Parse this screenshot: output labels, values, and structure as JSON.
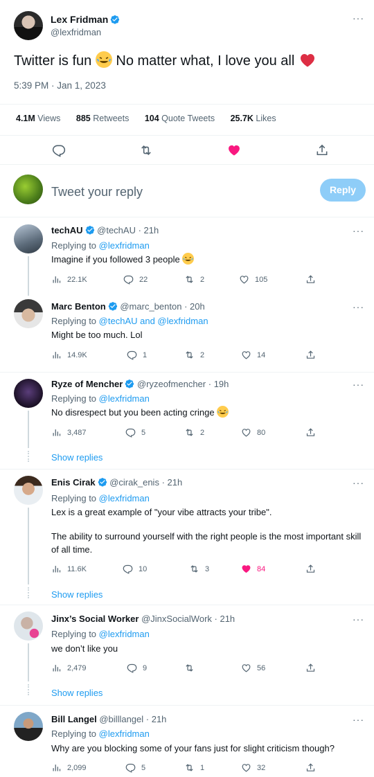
{
  "main_tweet": {
    "name": "Lex Fridman",
    "handle": "@lexfridman",
    "text": "Twitter is fun",
    "text2": "No matter what, I love you all",
    "time": "5:39 PM · Jan 1, 2023",
    "stats": {
      "views_num": "4.1M",
      "views_label": "Views",
      "retweets_num": "885",
      "retweets_label": "Retweets",
      "quotes_num": "104",
      "quotes_label": "Quote Tweets",
      "likes_num": "25.7K",
      "likes_label": "Likes"
    }
  },
  "reply_box": {
    "placeholder": "Tweet your reply",
    "button": "Reply"
  },
  "more_label": "···",
  "show_replies": "Show replies",
  "replying_to": "Replying to",
  "replies": [
    {
      "name": "techAU",
      "handle": "@techAU",
      "time": "· 21h",
      "to": "@lexfridman",
      "text": "Imagine if you followed 3 people",
      "views": "22.1K",
      "replies": "22",
      "retweets": "2",
      "likes": "105"
    },
    {
      "name": "Marc Benton",
      "handle": "@marc_benton",
      "time": "· 20h",
      "to": "@techAU and @lexfridman",
      "text": "Might be too much. Lol",
      "views": "14.9K",
      "replies": "1",
      "retweets": "2",
      "likes": "14"
    },
    {
      "name": "Ryze of Mencher",
      "handle": "@ryzeofmencher",
      "time": "· 19h",
      "to": "@lexfridman",
      "text": "No disrespect but you been acting cringe",
      "views": "3,487",
      "replies": "5",
      "retweets": "2",
      "likes": "80"
    },
    {
      "name": "Enis Cirak",
      "handle": "@cirak_enis",
      "time": "· 21h",
      "to": "@lexfridman",
      "text": "Lex is a great example of \"your vibe attracts your tribe\".",
      "text2": "The ability to surround yourself with the right people is the most important skill of all time.",
      "views": "11.6K",
      "replies": "10",
      "retweets": "3",
      "likes": "84"
    },
    {
      "name": "Jinx’s Social Worker",
      "handle": "@JinxSocialWork",
      "time": "· 21h",
      "to": "@lexfridman",
      "text": "we don’t like you",
      "views": "2,479",
      "replies": "9",
      "retweets": "",
      "likes": "56"
    },
    {
      "name": "Bill Langel",
      "handle": "@billlangel",
      "time": "· 21h",
      "to": "@lexfridman",
      "text": "Why are you blocking some of your fans just for slight criticism though?",
      "views": "2,099",
      "replies": "5",
      "retweets": "1",
      "likes": "32"
    }
  ],
  "colors": {
    "accent": "#1d9bf0",
    "like": "#f91880",
    "muted": "#536471"
  }
}
